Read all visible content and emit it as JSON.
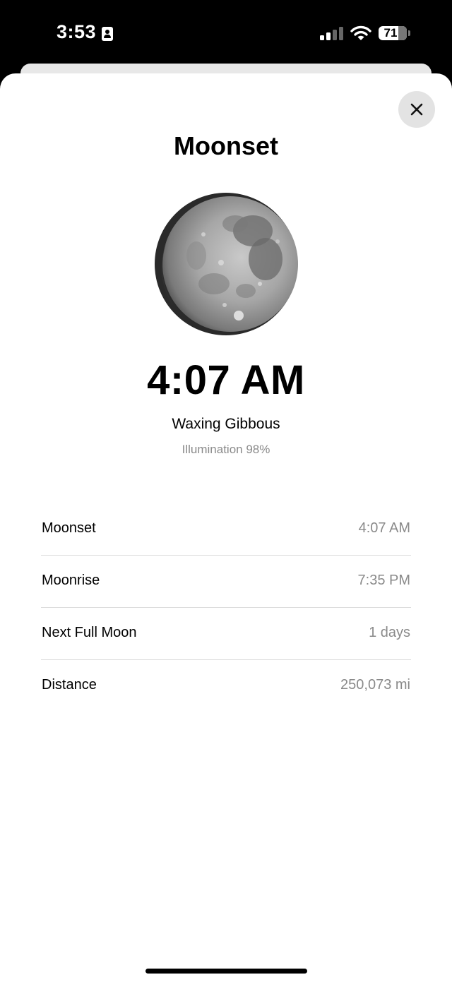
{
  "status": {
    "time": "3:53",
    "battery": "71",
    "signal_bars_active": 2,
    "signal_bars_total": 4
  },
  "sheet": {
    "title": "Moonset",
    "time": "4:07 AM",
    "phase": "Waxing Gibbous",
    "illumination": "Illumination 98%"
  },
  "details": [
    {
      "label": "Moonset",
      "value": "4:07 AM"
    },
    {
      "label": "Moonrise",
      "value": "7:35 PM"
    },
    {
      "label": "Next Full Moon",
      "value": "1 days"
    },
    {
      "label": "Distance",
      "value": "250,073 mi"
    }
  ],
  "icons": {
    "close": "close-icon",
    "contact": "contact-card-icon",
    "signal": "cellular-signal-icon",
    "wifi": "wifi-icon",
    "battery": "battery-icon"
  }
}
